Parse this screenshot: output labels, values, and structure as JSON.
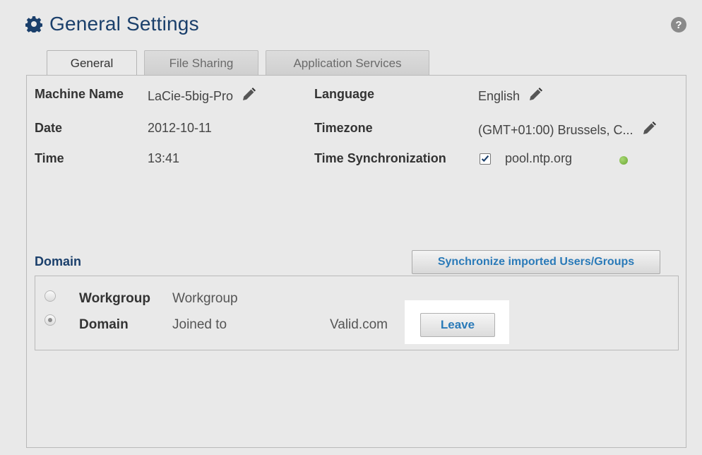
{
  "header": {
    "title": "General Settings",
    "icon": "gear-icon",
    "help_icon": "question-icon",
    "help_glyph": "?"
  },
  "tabs": [
    {
      "label": "General",
      "active": true
    },
    {
      "label": "File Sharing",
      "active": false
    },
    {
      "label": "Application Services",
      "active": false
    }
  ],
  "general": {
    "machine_name": {
      "label": "Machine Name",
      "value": "LaCie-5big-Pro"
    },
    "date": {
      "label": "Date",
      "value": "2012-10-11"
    },
    "time": {
      "label": "Time",
      "value": "13:41"
    },
    "language": {
      "label": "Language",
      "value": "English"
    },
    "timezone": {
      "label": "Timezone",
      "value": "(GMT+01:00) Brussels, C..."
    },
    "time_sync": {
      "label": "Time Synchronization",
      "checked": true,
      "server": "pool.ntp.org",
      "status_color": "#7bbf45"
    }
  },
  "domain": {
    "section_title": "Domain",
    "sync_button": "Synchronize imported Users/Groups",
    "workgroup": {
      "label": "Workgroup",
      "value": "Workgroup",
      "selected": false
    },
    "domain": {
      "label": "Domain",
      "value": "Joined to",
      "name": "Valid.com",
      "selected": true
    },
    "leave_button": "Leave"
  },
  "colors": {
    "accent": "#1a3f6b",
    "link": "#2a7ab8",
    "background": "#e9e9e9"
  }
}
